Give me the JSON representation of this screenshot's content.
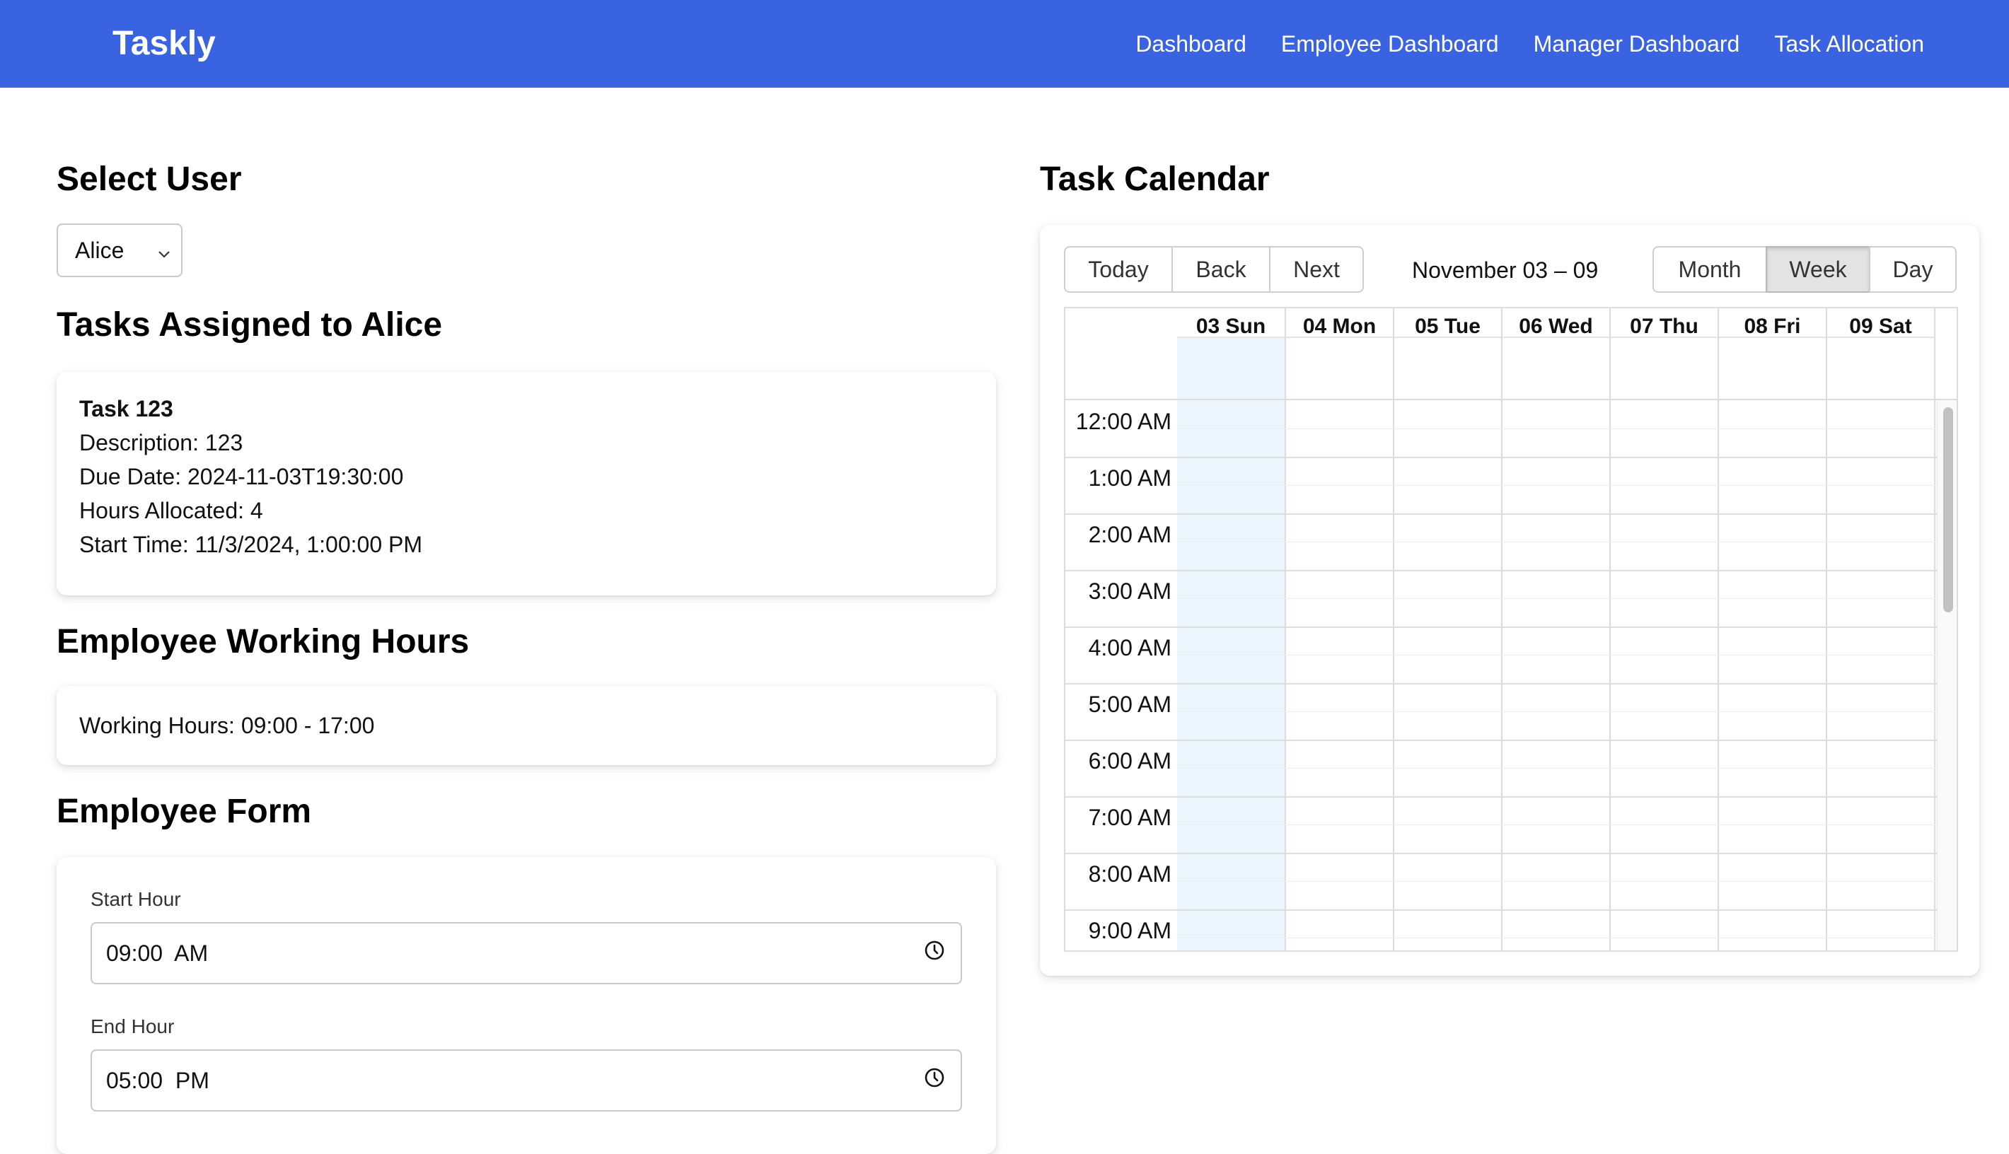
{
  "app": {
    "brand": "Taskly"
  },
  "nav": {
    "links": [
      "Dashboard",
      "Employee Dashboard",
      "Manager Dashboard",
      "Task Allocation"
    ]
  },
  "select_user": {
    "title": "Select User",
    "selected": "Alice"
  },
  "tasks": {
    "title": "Tasks Assigned to Alice",
    "items": [
      {
        "name": "Task 123",
        "description": "Description: 123",
        "due_date": "Due Date: 2024-11-03T19:30:00",
        "hours": "Hours Allocated: 4",
        "start_time": "Start Time: 11/3/2024, 1:00:00 PM"
      }
    ]
  },
  "working_hours": {
    "title": "Employee Working Hours",
    "text": "Working Hours: 09:00 - 17:00"
  },
  "employee_form": {
    "title": "Employee Form",
    "start_label": "Start Hour",
    "start_value": "09:00  AM",
    "end_label": "End Hour",
    "end_value": "05:00  PM"
  },
  "calendar": {
    "title": "Task Calendar",
    "nav_buttons": [
      "Today",
      "Back",
      "Next"
    ],
    "range": "November 03 – 09",
    "view_buttons": [
      "Month",
      "Week",
      "Day"
    ],
    "active_view": "Week",
    "days": [
      "03 Sun",
      "04 Mon",
      "05 Tue",
      "06 Wed",
      "07 Thu",
      "08 Fri",
      "09 Sat"
    ],
    "today_index": 0,
    "hours": [
      "12:00 AM",
      "1:00 AM",
      "2:00 AM",
      "3:00 AM",
      "4:00 AM",
      "5:00 AM",
      "6:00 AM",
      "7:00 AM",
      "8:00 AM",
      "9:00 AM"
    ]
  },
  "colors": {
    "navbar": "#3a63e2",
    "today_column": "#eaf5fe",
    "active_button": "#e3e3e3"
  }
}
